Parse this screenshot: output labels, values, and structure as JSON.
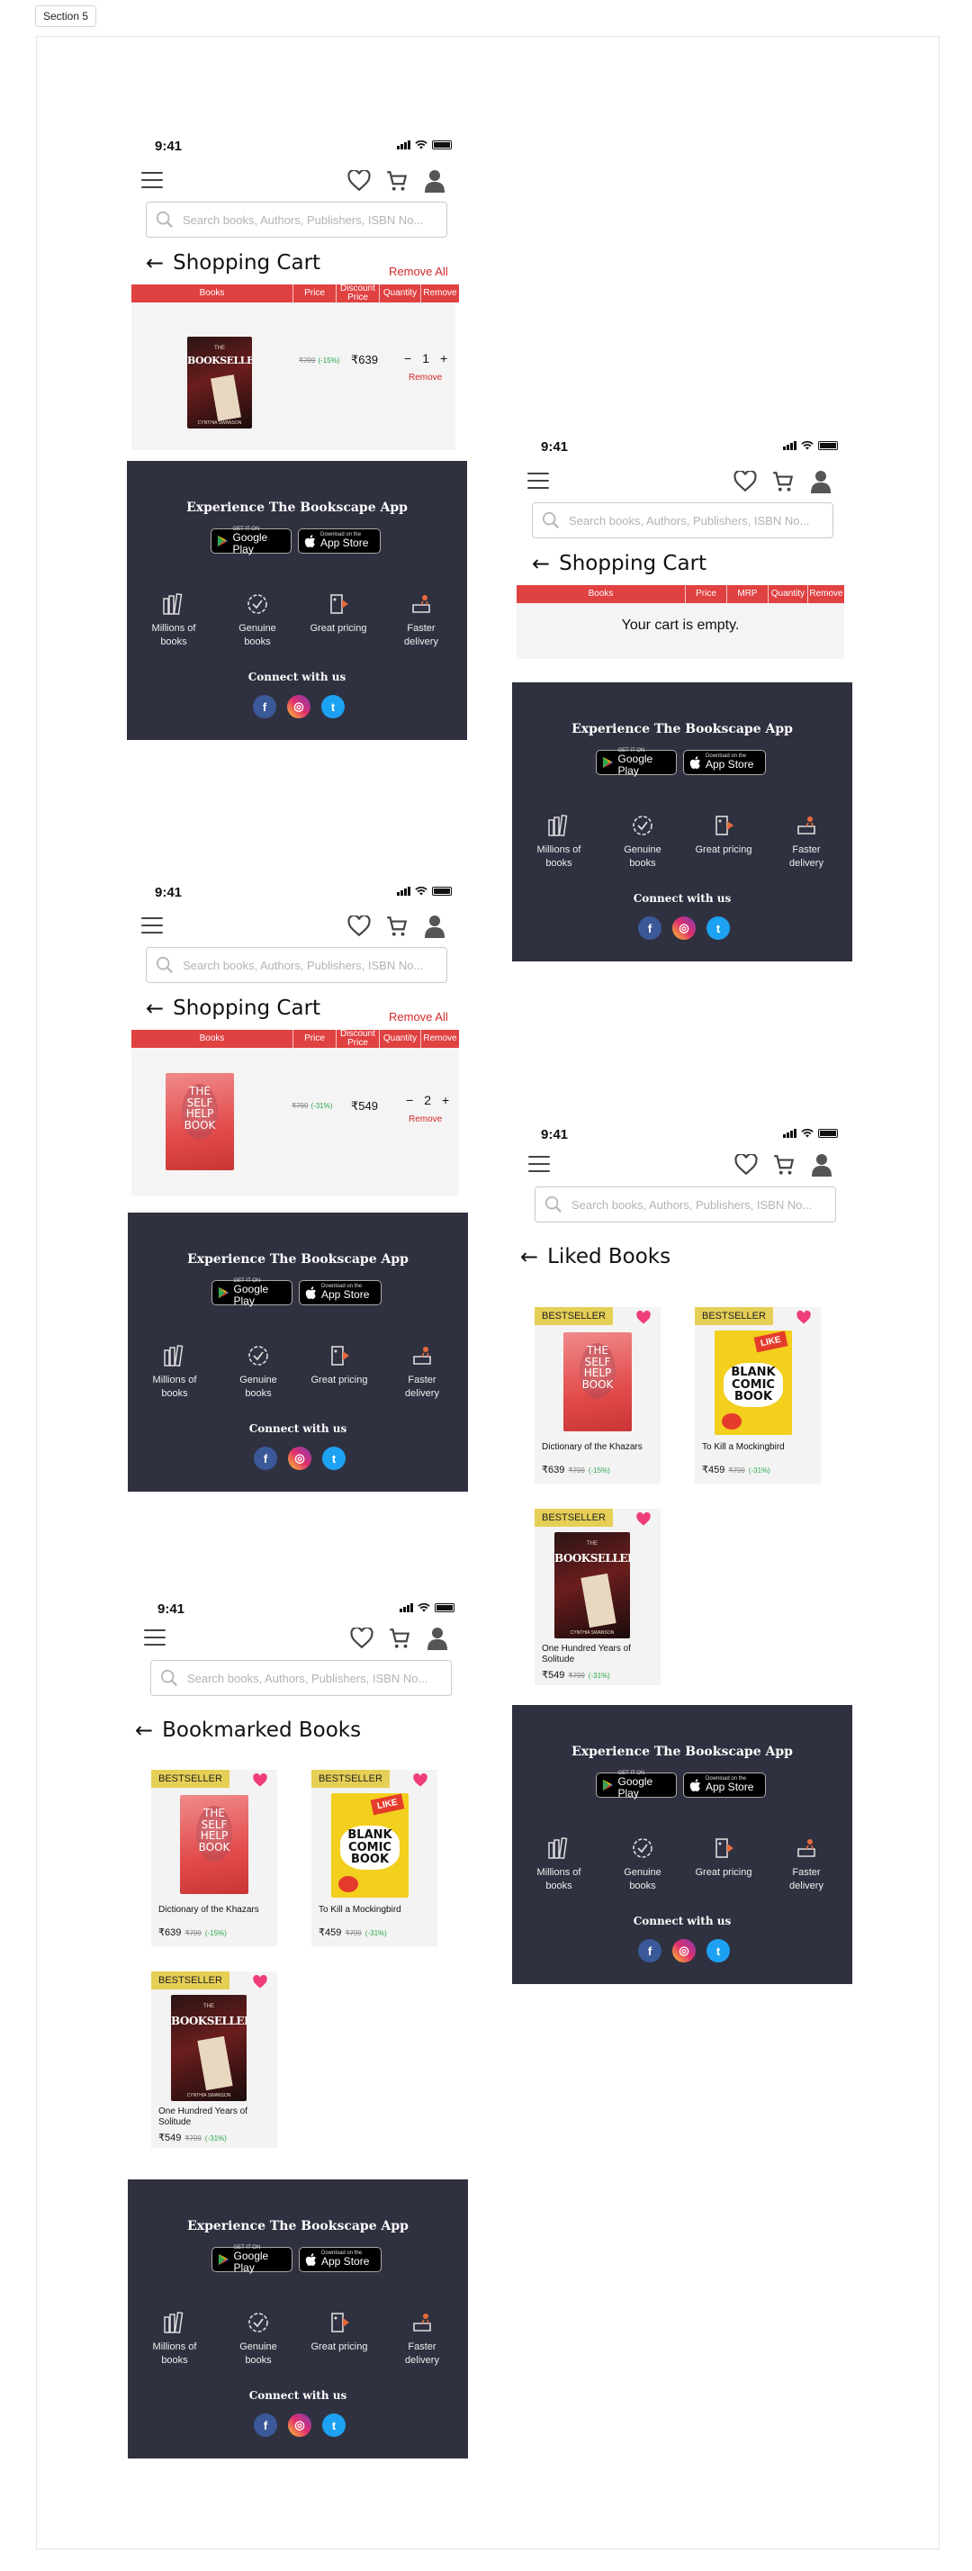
{
  "section_label": "Section 5",
  "status": {
    "time": "9:41"
  },
  "search": {
    "placeholder": "Search books, Authors, Publishers, ISBN No..."
  },
  "back_arrow": "←",
  "cart": {
    "title": "Shopping Cart",
    "remove_all": "Remove All",
    "columns": [
      "Books",
      "Price",
      "Discount Price",
      "Quantity",
      "Remove"
    ],
    "empty_columns": [
      "Books",
      "Price",
      "MRP",
      "Quantity",
      "Remove"
    ],
    "empty_text": "Your cart is empty.",
    "remove_label": "Remove",
    "minus": "−",
    "plus": "+",
    "items": [
      {
        "old_price": "₹799",
        "discount": "(-15%)",
        "price": "₹639",
        "qty": "1"
      },
      {
        "old_price": "₹799",
        "discount": "(-31%)",
        "price": "₹549",
        "qty": "2"
      }
    ]
  },
  "liked": {
    "title": "Liked Books"
  },
  "bookmarked": {
    "title": "Bookmarked Books"
  },
  "books": [
    {
      "badge": "BESTSELLER",
      "title": "Dictionary of the Khazars",
      "price": "₹639",
      "old_price": "₹799",
      "discount": "(-15%)"
    },
    {
      "badge": "BESTSELLER",
      "title": "To Kill a Mockingbird",
      "price": "₹459",
      "old_price": "₹799",
      "discount": "(-31%)"
    },
    {
      "badge": "BESTSELLER",
      "title": "One Hundred Years of Solitude",
      "price": "₹549",
      "old_price": "₹799",
      "discount": "(-31%)"
    }
  ],
  "covers": {
    "bookseller": {
      "word": "BOOKSELLER",
      "small": "THE",
      "author": "CYNTHIA SWANSON"
    },
    "selfhelp": {
      "lines": [
        "THE",
        "SELF",
        "HELP",
        "BOOK"
      ]
    },
    "comic": {
      "lines": [
        "BLANK",
        "COMIC",
        "BOOK"
      ],
      "burst": "LIKE"
    }
  },
  "footer": {
    "title": "Experience The Bookscape App",
    "google_small": "GET IT ON",
    "google_big": "Google Play",
    "apple_small": "Download on the",
    "apple_big": "App Store",
    "features": [
      "Millions of books",
      "Genuine books",
      "Great pricing",
      "Faster delivery"
    ],
    "connect": "Connect with us",
    "social": [
      "f",
      "◎",
      "t"
    ]
  },
  "colors": {
    "accent_red": "#e04141",
    "footer_bg": "#2f3140",
    "badge": "#e6cf56",
    "heart": "#ee3d7a",
    "discount_green": "#2aa84a"
  }
}
